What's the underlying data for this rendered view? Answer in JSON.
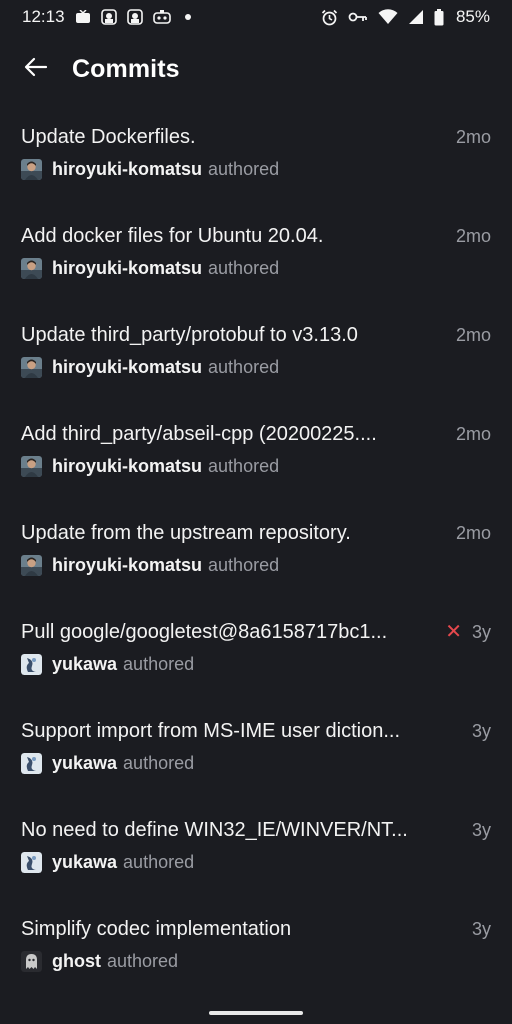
{
  "status_bar": {
    "time": "12:13",
    "battery": "85%",
    "left_icons": [
      "tv-icon",
      "notification-app-icon",
      "notification-app-icon",
      "game-controller-icon"
    ],
    "right_icons": [
      "alarm-icon",
      "vpn-key-icon",
      "wifi-icon",
      "cell-signal-icon",
      "battery-icon"
    ]
  },
  "header": {
    "back_icon": "arrow-left-icon",
    "title": "Commits"
  },
  "colors": {
    "background": "#1b1c21",
    "text_primary": "#f3f3f3",
    "text_secondary": "#9a9ca3",
    "failure": "#e5484d"
  },
  "commits": [
    {
      "message": "Update Dockerfiles.",
      "author": "hiroyuki-komatsu",
      "action": "authored",
      "time": "2mo",
      "status": "",
      "avatar": "photo"
    },
    {
      "message": "Add docker files for Ubuntu 20.04.",
      "author": "hiroyuki-komatsu",
      "action": "authored",
      "time": "2mo",
      "status": "",
      "avatar": "photo"
    },
    {
      "message": "Update third_party/protobuf to v3.13.0",
      "author": "hiroyuki-komatsu",
      "action": "authored",
      "time": "2mo",
      "status": "",
      "avatar": "photo"
    },
    {
      "message": "Add third_party/abseil-cpp (20200225....",
      "author": "hiroyuki-komatsu",
      "action": "authored",
      "time": "2mo",
      "status": "",
      "avatar": "photo"
    },
    {
      "message": "Update from the upstream repository.",
      "author": "hiroyuki-komatsu",
      "action": "authored",
      "time": "2mo",
      "status": "",
      "avatar": "photo"
    },
    {
      "message": "Pull google/googletest@8a6158717bc1...",
      "author": "yukawa",
      "action": "authored",
      "time": "3y",
      "status": "✕",
      "avatar": "logo"
    },
    {
      "message": "Support import from MS-IME user diction...",
      "author": "yukawa",
      "action": "authored",
      "time": "3y",
      "status": "",
      "avatar": "logo"
    },
    {
      "message": "No need to define WIN32_IE/WINVER/NT...",
      "author": "yukawa",
      "action": "authored",
      "time": "3y",
      "status": "",
      "avatar": "logo"
    },
    {
      "message": "Simplify codec implementation",
      "author": "ghost",
      "action": "authored",
      "time": "3y",
      "status": "",
      "avatar": "ghost"
    }
  ]
}
